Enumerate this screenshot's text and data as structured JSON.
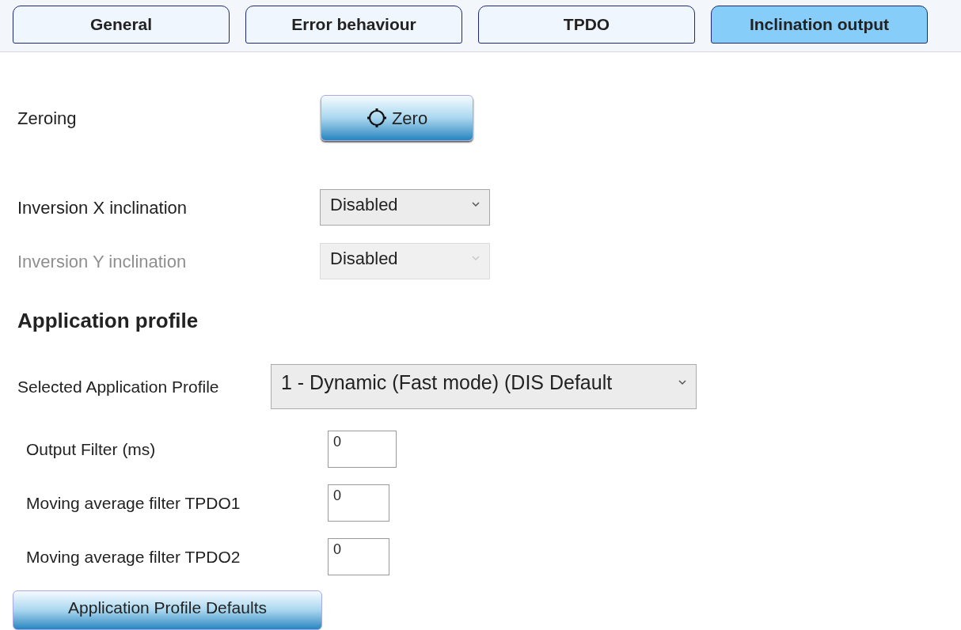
{
  "tabs": [
    {
      "label": "General",
      "selected": false
    },
    {
      "label": "Error behaviour",
      "selected": false
    },
    {
      "label": "TPDO",
      "selected": false
    },
    {
      "label": "Inclination output",
      "selected": true
    }
  ],
  "zeroing": {
    "label": "Zeroing",
    "button": "Zero"
  },
  "inversions": [
    {
      "label": "Inversion X inclination",
      "value": "Disabled",
      "disabled": false
    },
    {
      "label": "Inversion Y inclination",
      "value": "Disabled",
      "disabled": true
    }
  ],
  "application_profile": {
    "heading": "Application profile",
    "label": "Selected Application Profile",
    "value": "1 - Dynamic (Fast mode) (DIS Default",
    "filters": [
      {
        "label": "Output Filter (ms)",
        "value": "0"
      },
      {
        "label": "Moving average filter TPDO1",
        "value": "0"
      },
      {
        "label": "Moving average filter TPDO2",
        "value": "0"
      }
    ],
    "defaults_button": "Application Profile Defaults"
  }
}
